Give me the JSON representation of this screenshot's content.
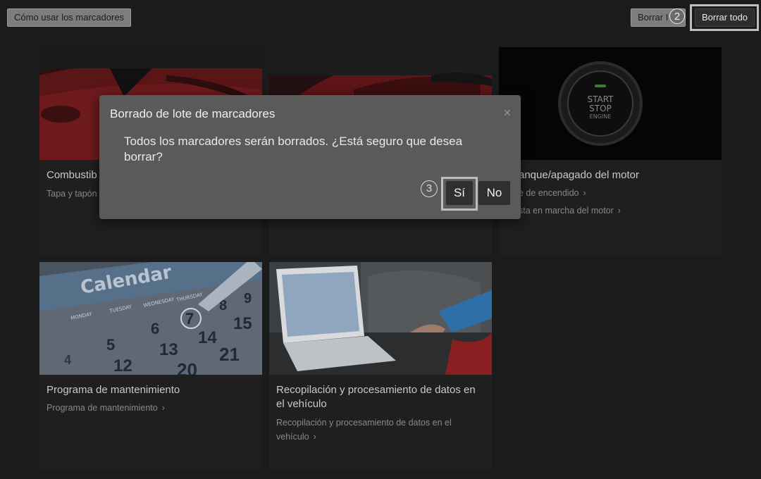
{
  "toolbar": {
    "how_to_label": "Cómo usar los marcadores",
    "delete_partial_label": "Borrar I",
    "delete_all_label": "Borrar todo",
    "step_2": "2"
  },
  "cards": [
    {
      "title": "Combustib",
      "links": [
        "Tapa y tapón"
      ]
    },
    {
      "title": "",
      "links": []
    },
    {
      "title": "anque/apagado del motor",
      "links": [
        "e de encendido",
        "sta en marcha del motor"
      ],
      "image_text": [
        "START",
        "STOP",
        "ENGINE"
      ]
    },
    {
      "title": "Programa de mantenimiento",
      "links": [
        "Programa de mantenimiento"
      ],
      "image_text": [
        "Calendar",
        "MONDAY",
        "TUESDAY",
        "WEDNESDAY",
        "THURSDAY",
        "5",
        "6",
        "7",
        "8",
        "9",
        "12",
        "13",
        "14",
        "15",
        "20",
        "21",
        "4"
      ]
    },
    {
      "title": "Recopilación y procesamiento de datos en el vehículo",
      "links": [
        "Recopilación y procesamiento de datos en el vehículo"
      ]
    }
  ],
  "dialog": {
    "title": "Borrado de lote de marcadores",
    "close_icon": "×",
    "message": "Todos los marcadores serán borrados. ¿Está seguro que desea borrar?",
    "step_3": "3",
    "yes_label": "Sí",
    "no_label": "No"
  },
  "colors": {
    "background": "#1b1b1b",
    "dialog": "#5a5a5a",
    "button": "#2f2f2f"
  }
}
